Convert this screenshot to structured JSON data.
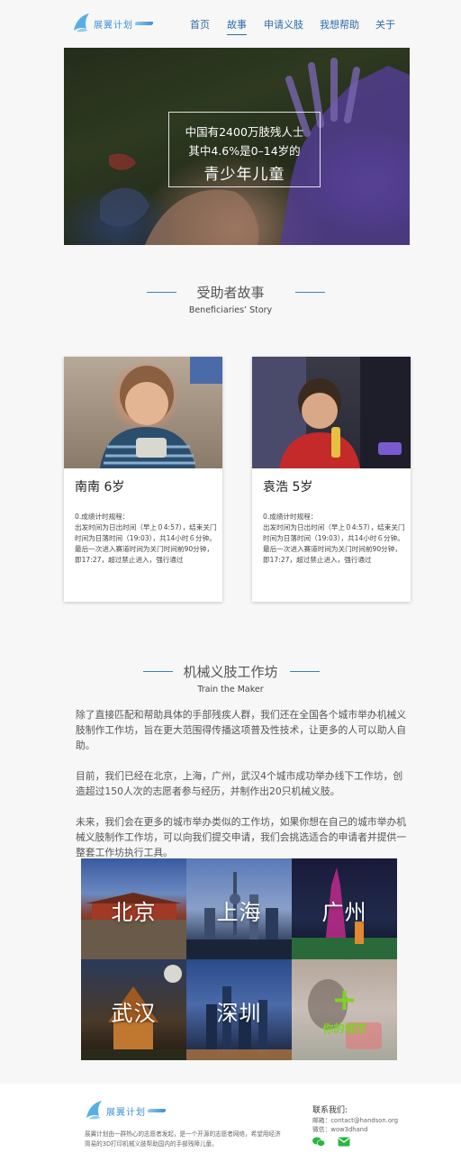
{
  "header": {
    "logo_text": "展翼计划",
    "nav": [
      {
        "label": "首页",
        "active": false
      },
      {
        "label": "故事",
        "active": true
      },
      {
        "label": "申请义肢",
        "active": false
      },
      {
        "label": "我想帮助",
        "active": false
      },
      {
        "label": "关于",
        "active": false
      }
    ]
  },
  "hero": {
    "line1": "中国有2400万肢残人士",
    "line2": "其中4.6%是0–14岁的",
    "line3": "青少年儿童"
  },
  "stories": {
    "title": "受助者故事",
    "subtitle": "Beneficiaries’ Story",
    "cards": [
      {
        "name": "南南  6岁",
        "body_title": "0.成绩计时规程：",
        "body": "出发时间为日出时间（早上０4:57），结束关门时间为日落时间（19:03），共14小时６分钟。最后一次进入赛道时间为关门时间前90分钟，即17:27，超过禁止进入，强行通过"
      },
      {
        "name": "袁浩 5岁",
        "body_title": "0.成绩计时规程：",
        "body": "出发时间为日出时间（早上０4:57），结束关门时间为日落时间（19:03），共14小时６分钟。最后一次进入赛道时间为关门时间前90分钟，即17:27，超过禁止进入，强行通过"
      }
    ]
  },
  "workshop": {
    "title": "机械义肢工作坊",
    "subtitle": "Train the Maker",
    "paragraphs": [
      "除了直接匹配和帮助具体的手部残疾人群，我们还在全国各个城市举办机械义肢制作工作坊，旨在更大范围得传播这项普及性技术，让更多的人可以助人自助。",
      "目前，我们已经在北京，上海，广州，武汉4个城市成功举办线下工作坊，创造超过150人次的志愿者参与经历，并制作出20只机械义肢。",
      "未来，我们会在更多的城市举办类似的工作坊，如果你想在自己的城市举办机械义肢制作工作坊，可以向我们提交申请，我们会挑选适合的申请者并提供一整套工作坊执行工具。"
    ],
    "cities": [
      "北京",
      "上海",
      "广州",
      "武汉",
      "深圳"
    ],
    "your_city_icon": "+",
    "your_city": "你的城市"
  },
  "footer": {
    "logo_text": "展翼计划",
    "description": "展翼计划由一群热心的志愿者发起，是一个开源的志愿者网络，希望用经济简易的3D打印机械义肢帮助国内的手部残障儿童。",
    "contact_title": "联系我们:",
    "email_line": "邮箱：contact@handson.org",
    "wechat_line": "微信：wow3dhand",
    "icons": [
      "wechat-icon",
      "mail-icon"
    ]
  },
  "colors": {
    "brand_blue": "#3d8fd8",
    "nav_blue": "#2d6aa6",
    "accent_green": "#7ed321"
  }
}
